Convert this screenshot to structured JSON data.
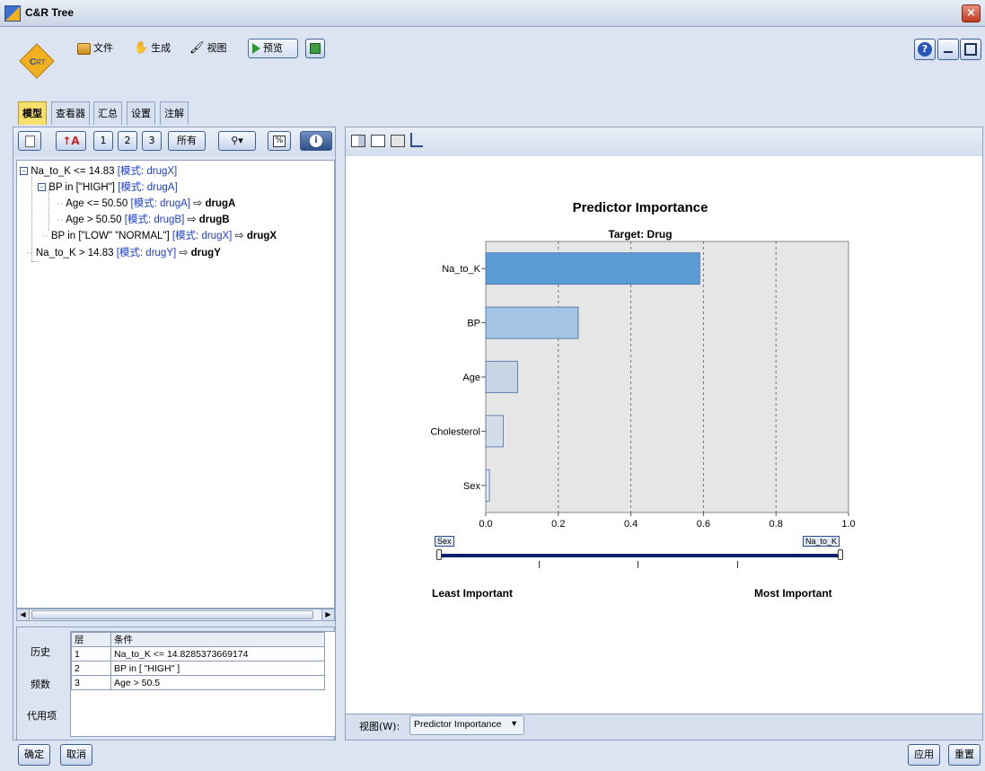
{
  "window": {
    "title": "C&R Tree",
    "close": "×"
  },
  "toolbar": {
    "file": "文件",
    "generate": "生成",
    "view": "视图",
    "preview": "预览"
  },
  "tabs": [
    "模型",
    "查看器",
    "汇总",
    "设置",
    "注解"
  ],
  "tree_toolbar": {
    "level1": "1",
    "level2": "2",
    "level3": "3",
    "all": "所有"
  },
  "tree": {
    "n1_label": "Na_to_K <= 14.83",
    "n1_mode": "[模式: drugX]",
    "n2_label": "BP in [\"HIGH\"]",
    "n2_mode": "[模式: drugA]",
    "n3_label": "Age <= 50.50",
    "n3_mode": "[模式: drugA]",
    "n3_result": "drugA",
    "n4_label": "Age > 50.50",
    "n4_mode": "[模式: drugB]",
    "n4_result": "drugB",
    "n5_label": "BP in [\"LOW\" \"NORMAL\"]",
    "n5_mode": "[模式: drugX]",
    "n5_result": "drugX",
    "n6_label": "Na_to_K > 14.83",
    "n6_mode": "[模式: drugY]",
    "n6_result": "drugY"
  },
  "side_labels": {
    "history": "历史",
    "frequency": "频数",
    "surrogates": "代用项"
  },
  "conditions": {
    "col_level": "层",
    "col_condition": "条件",
    "rows": [
      {
        "level": "1",
        "condition": "Na_to_K <= 14.8285373669174"
      },
      {
        "level": "2",
        "condition": "BP in [ \"HIGH\" ]"
      },
      {
        "level": "3",
        "condition": "Age > 50.5"
      }
    ]
  },
  "view_bar": {
    "label": "视图(W):",
    "selected": "Predictor Importance"
  },
  "footer": {
    "ok": "确定",
    "cancel": "取消",
    "apply": "应用",
    "reset": "重置"
  },
  "slider": {
    "left_tag": "Sex",
    "right_tag": "Na_to_K",
    "least": "Least Important",
    "most": "Most Important"
  },
  "chart_data": {
    "type": "bar",
    "orientation": "horizontal",
    "title": "Predictor Importance",
    "subtitle": "Target: Drug",
    "categories": [
      "Na_to_K",
      "BP",
      "Age",
      "Cholesterol",
      "Sex"
    ],
    "values": [
      0.59,
      0.255,
      0.088,
      0.048,
      0.01
    ],
    "colors": [
      "#5b9bd5",
      "#a3c4e2",
      "#c6d4e3",
      "#d3dde9",
      "#e2e8f0"
    ],
    "xlim": [
      0.0,
      1.0
    ],
    "xticks": [
      "0.0",
      "0.2",
      "0.4",
      "0.6",
      "0.8",
      "1.0"
    ],
    "grid": "vertical dashed",
    "background": "#e6e6e6"
  }
}
